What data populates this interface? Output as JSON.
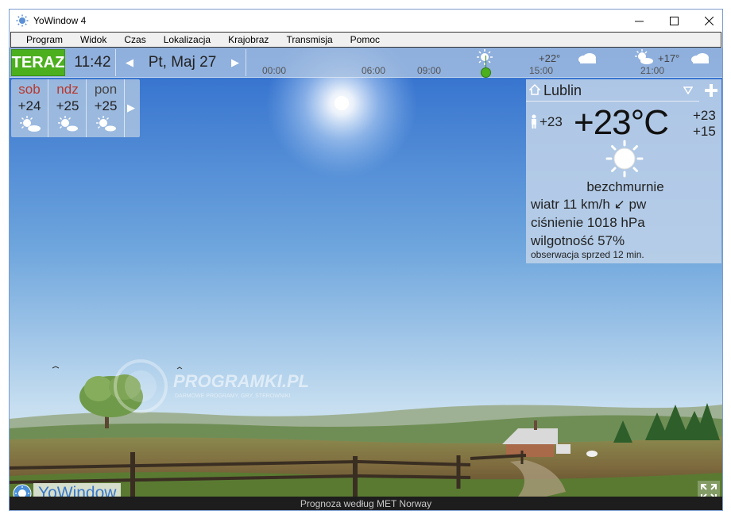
{
  "window": {
    "title": "YoWindow 4"
  },
  "menu": [
    "Program",
    "Widok",
    "Czas",
    "Lokalizacja",
    "Krajobraz",
    "Transmisja",
    "Pomoc"
  ],
  "topbar": {
    "now_label": "TERAZ",
    "time": "11:42",
    "date": "Pt, Maj 27",
    "timeline_ticks": [
      "00:00",
      "06:00",
      "09:00",
      "15:00",
      "21:00"
    ],
    "timeline_temps": [
      "+22°",
      "+17°"
    ]
  },
  "days": [
    {
      "name": "sob",
      "temp": "+24",
      "name_color": "#b8382d"
    },
    {
      "name": "ndz",
      "temp": "+25",
      "name_color": "#b8382d"
    },
    {
      "name": "pon",
      "temp": "+25",
      "name_color": "#444444"
    }
  ],
  "current": {
    "city": "Lublin",
    "feels_like": "+23",
    "temperature": "+23°C",
    "high": "+23",
    "low": "+15",
    "condition": "bezchmurnie",
    "wind": "wiatr  11 km/h ↙ pw",
    "pressure": "ciśnienie  1018 hPa",
    "humidity": "wilgotność  57%",
    "observed": "obserwacja sprzed 12 min."
  },
  "watermark": {
    "brand": "PROGRAMKI.PL",
    "tagline": "DARMOWE PROGRAMY, GRY, STEROWNIKI"
  },
  "logo_text": "YoWindow",
  "footer": "Prognoza według MET Norway",
  "colors": {
    "accent": "#4caf1e",
    "sky_top": "#2f6fd0",
    "sky_bottom": "#cfe3f1"
  }
}
